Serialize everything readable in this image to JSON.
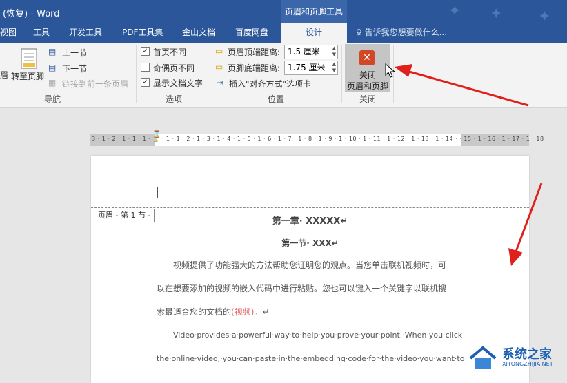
{
  "titlebar": {
    "title": "(恢复) - Word",
    "context_tools": "页眉和页脚工具"
  },
  "tabs": [
    "视图",
    "工具",
    "开发工具",
    "PDF工具集",
    "金山文档",
    "百度网盘",
    "设计"
  ],
  "tell_me": "告诉我您想要做什么...",
  "ribbon": {
    "nav": {
      "partial": "眉",
      "goto_footer": "转至页脚",
      "prev": "上一节",
      "next": "下一节",
      "link_prev": "链接到前一条页眉",
      "label": "导航"
    },
    "options": {
      "diff_first": "首页不同",
      "diff_odd_even": "奇偶页不同",
      "show_text": "显示文档文字",
      "label": "选项",
      "checked": [
        true,
        false,
        true
      ]
    },
    "position": {
      "header_dist_label": "页眉顶端距离:",
      "header_dist_value": "1.5 厘米",
      "footer_dist_label": "页脚底端距离:",
      "footer_dist_value": "1.75 厘米",
      "align_tab": "插入\"对齐方式\"选项卡",
      "label": "位置"
    },
    "close": {
      "line1": "关闭",
      "line2": "页眉和页脚",
      "label": "关闭"
    }
  },
  "ruler": {
    "numbers": "3 · 1 · 2 · 1 · 1 · 1 · ⌛ · 1 · 1 · 2 · 1 · 3 · 1 · 4 · 1 · 5 · 1 · 6 · 1 · 7 · 1 · 8 · 1 · 9 · 1 · 10 · 1 · 11 · 1 · 12 · 1 · 13 · 1 · 14 ·   · 15 · 1 · 16 · 1 · 17 · 1 · 18"
  },
  "document": {
    "header_tag": "页眉 - 第 1 节 -",
    "chapter": "第一章· XXXXX↵",
    "section": "第一节· XXX↵",
    "p1_line1": "视频提供了功能强大的方法帮助您证明您的观点。当您单击联机视频时，可",
    "p1_line2": "以在想要添加的视频的嵌入代码中进行粘贴。您也可以键入一个关键字以联机搜",
    "p1_line3_a": "索最适合您的文档的",
    "p1_line3_link": "(视频)",
    "p1_line3_b": "。↵",
    "p2_line1": "Video·provides·a·powerful·way·to·help·you·prove·your·point.·When·you·click",
    "p2_line2": "the·online·video,·you·can·paste·in·the·embedding·code·for·the·video·you·want·to"
  },
  "watermark": {
    "name": "系统之家",
    "url": "XITONGZHIJIA.NET"
  },
  "colors": {
    "title_blue": "#2b579a",
    "close_red": "#d24726",
    "arrow_red": "#e0201a"
  }
}
